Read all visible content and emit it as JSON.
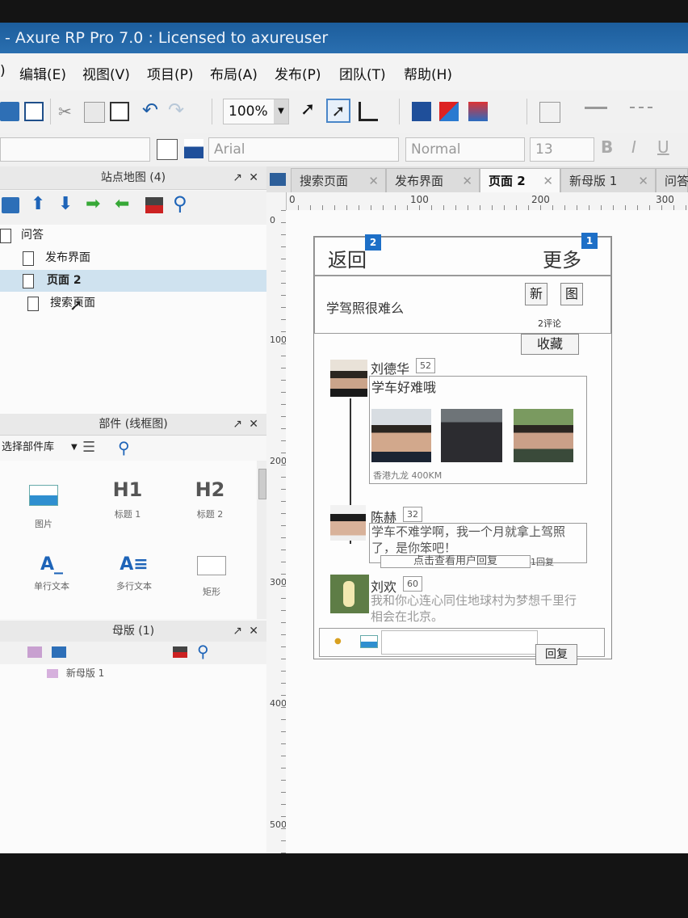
{
  "window": {
    "title": "- Axure RP Pro 7.0 : Licensed to axureuser"
  },
  "menu": [
    "编辑(E)",
    "视图(V)",
    "项目(P)",
    "布局(A)",
    "发布(P)",
    "团队(T)",
    "帮助(H)"
  ],
  "menu_prefix": ")",
  "toolbar": {
    "zoom": "100%"
  },
  "format_bar": {
    "font": "Arial",
    "style": "Normal",
    "size": "13",
    "bold": "B",
    "italic": "I",
    "underline": "U"
  },
  "sitemap": {
    "title": "站点地图 (4)",
    "pages": [
      {
        "label": "问答"
      },
      {
        "label": "发布界面"
      },
      {
        "label": "页面 2"
      },
      {
        "label": "搜索页面"
      }
    ]
  },
  "widgets": {
    "title": "部件 (线框图)",
    "library": "选择部件库",
    "items": [
      {
        "glyph": "",
        "label": "图片"
      },
      {
        "glyph": "H1",
        "label": "标题 1"
      },
      {
        "glyph": "H2",
        "label": "标题 2"
      },
      {
        "glyph": "A_",
        "label": "单行文本"
      },
      {
        "glyph": "A≡",
        "label": "多行文本"
      },
      {
        "glyph": "",
        "label": "矩形"
      }
    ]
  },
  "masters": {
    "title": "母版 (1)",
    "items": [
      {
        "label": "新母版 1"
      }
    ]
  },
  "tabs": [
    {
      "label": "搜索页面"
    },
    {
      "label": "发布界面"
    },
    {
      "label": "页面 2"
    },
    {
      "label": "新母版 1"
    },
    {
      "label": "问答"
    }
  ],
  "ruler": {
    "h": [
      "0",
      "100",
      "200",
      "300"
    ],
    "v": [
      "0",
      "100",
      "200",
      "300",
      "400",
      "500"
    ]
  },
  "mockup": {
    "back": "返回",
    "more": "更多",
    "badge_back": "2",
    "badge_more": "1",
    "question": "学驾照很难么",
    "tag_new": "新",
    "tag_image": "图",
    "comment_count": "2评论",
    "favorite": "收藏",
    "posts": [
      {
        "name": "刘德华",
        "count": "52",
        "text": "学车好难哦",
        "location": "香港九龙 400KM"
      },
      {
        "name": "陈赫",
        "count": "32",
        "text": "学车不难学啊，我一个月就拿上驾照了，是你笨吧！",
        "reply_link": "点击查看用户回复",
        "reply_count": "1回复"
      },
      {
        "name": "刘欢",
        "count": "60",
        "text": "我和你心连心同住地球村为梦想千里行相会在北京。"
      }
    ],
    "reply_button": "回复"
  },
  "colors": {
    "accent": "#1d6fc7",
    "titlebar": "#2a6fb0"
  }
}
